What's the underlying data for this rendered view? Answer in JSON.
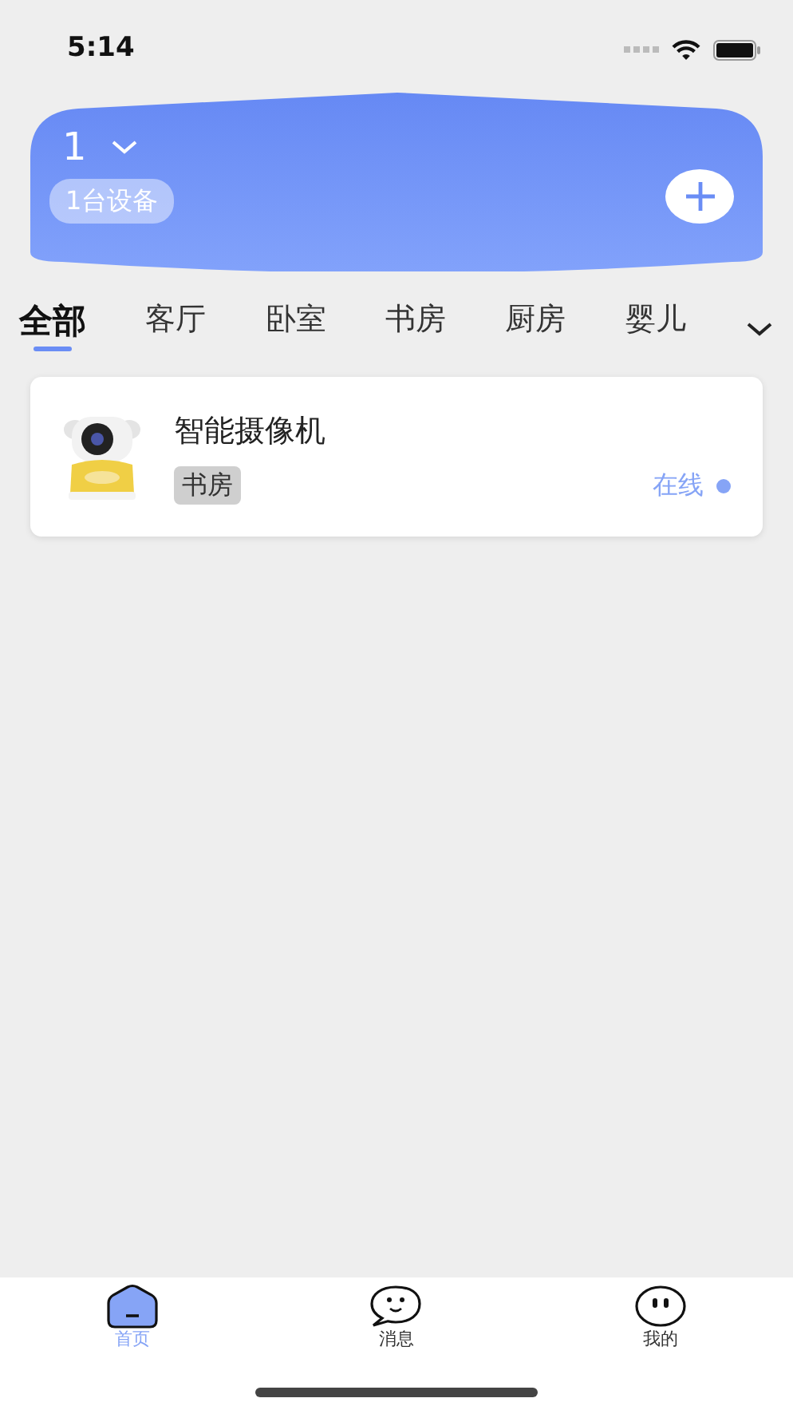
{
  "status_bar": {
    "time": "5:14"
  },
  "header": {
    "home_name": "1",
    "device_count": "1台设备"
  },
  "room_tabs": [
    {
      "label": "全部",
      "selected": true
    },
    {
      "label": "客厅",
      "selected": false
    },
    {
      "label": "卧室",
      "selected": false
    },
    {
      "label": "书房",
      "selected": false
    },
    {
      "label": "厨房",
      "selected": false
    },
    {
      "label": "婴儿",
      "selected": false
    }
  ],
  "devices": [
    {
      "name": "智能摄像机",
      "room": "书房",
      "status": "在线",
      "online": true
    }
  ],
  "bottom_nav": [
    {
      "label": "首页",
      "selected": true,
      "kind": "home"
    },
    {
      "label": "消息",
      "selected": false,
      "kind": "chat"
    },
    {
      "label": "我的",
      "selected": false,
      "kind": "face"
    }
  ]
}
